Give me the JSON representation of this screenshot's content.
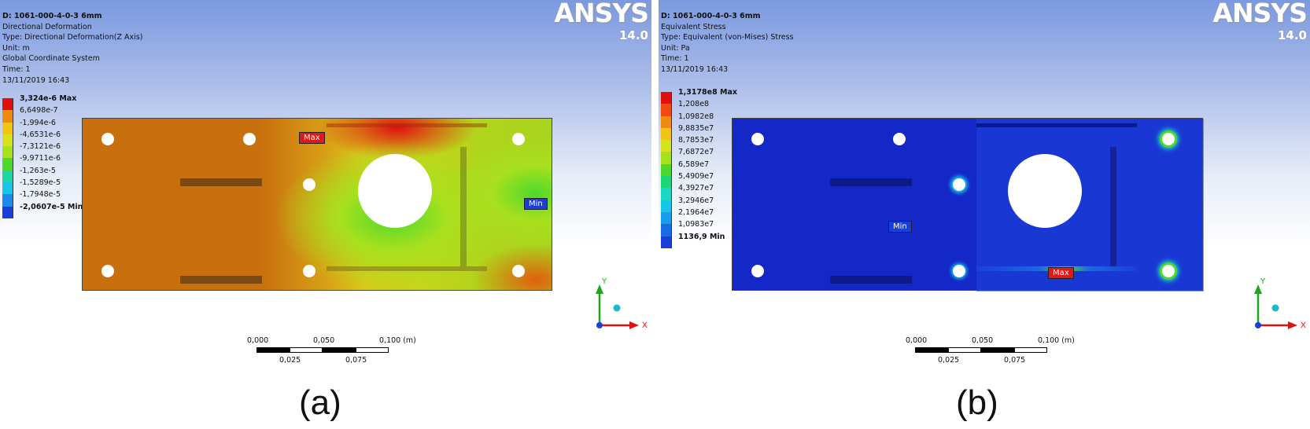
{
  "panels": [
    {
      "info": {
        "title": "D: 1061-000-4-0-3 6mm",
        "line1": "Directional Deformation",
        "line2": "Type: Directional Deformation(Z Axis)",
        "line3": "Unit: m",
        "line4": "Global Coordinate System",
        "line5": "Time: 1",
        "line6": "13/11/2019 16:43"
      },
      "logo": {
        "brand": "ANSYS",
        "version": "14.0"
      },
      "legend": {
        "labels": [
          "3,324e-6 Max",
          "6,6498e-7",
          "-1,994e-6",
          "-4,6531e-6",
          "-7,3121e-6",
          "-9,9711e-6",
          "-1,263e-5",
          "-1,5289e-5",
          "-1,7948e-5",
          "-2,0607e-5 Min"
        ],
        "colors": [
          "#e01010",
          "#f08a10",
          "#f2c414",
          "#d8e21a",
          "#a8e01e",
          "#4ed92a",
          "#1cd6a4",
          "#16c6e8",
          "#1a8aec",
          "#1a3fd8"
        ]
      },
      "markers": {
        "max": "Max",
        "min": "Min"
      },
      "triad": {
        "y": "Y",
        "x": "X"
      },
      "scale": {
        "t0": "0,000",
        "t1": "0,050",
        "t2": "0,100 (m)",
        "b1": "0,025",
        "b2": "0,075"
      }
    },
    {
      "info": {
        "title": "D: 1061-000-4-0-3 6mm",
        "line1": "Equivalent Stress",
        "line2": "Type: Equivalent (von-Mises) Stress",
        "line3": "Unit: Pa",
        "line4": "Time: 1",
        "line5": "13/11/2019 16:43"
      },
      "logo": {
        "brand": "ANSYS",
        "version": "14.0"
      },
      "legend": {
        "labels": [
          "1,3178e8 Max",
          "1,208e8",
          "1,0982e8",
          "9,8835e7",
          "8,7853e7",
          "7,6872e7",
          "6,589e7",
          "5,4909e7",
          "4,3927e7",
          "3,2946e7",
          "2,1964e7",
          "1,0983e7",
          "1136,9 Min"
        ],
        "colors": [
          "#e01010",
          "#f04a10",
          "#f08a10",
          "#f2c414",
          "#d8e21a",
          "#a8e01e",
          "#4ed92a",
          "#1cd67a",
          "#1cd6c4",
          "#16c6e8",
          "#1a9cec",
          "#1a6ae4",
          "#1a3fd8"
        ]
      },
      "markers": {
        "max": "Max",
        "min": "Min"
      },
      "triad": {
        "y": "Y",
        "x": "X"
      },
      "scale": {
        "t0": "0,000",
        "t1": "0,050",
        "t2": "0,100 (m)",
        "b1": "0,025",
        "b2": "0,075"
      }
    }
  ],
  "captions": {
    "a": "(a)",
    "b": "(b)"
  }
}
